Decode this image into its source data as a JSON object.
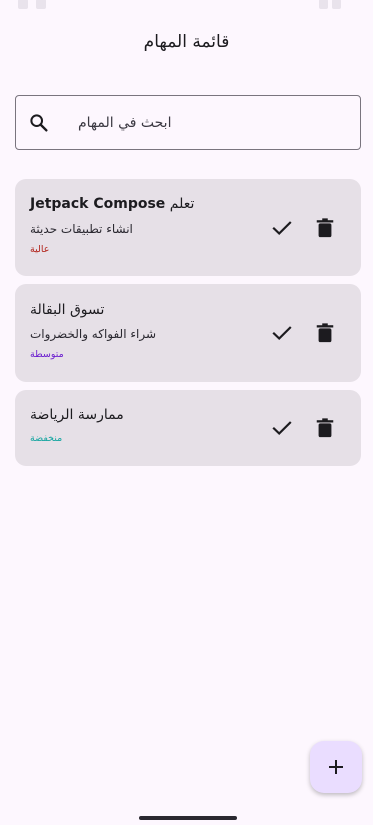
{
  "app": {
    "title": "قائمة المهام"
  },
  "search": {
    "placeholder": "ابحث في المهام"
  },
  "tasks": [
    {
      "title_prefix": "تعلم ",
      "title_bold": "Jetpack Compose",
      "description": "انشاء تطبيقات حديثة",
      "priority": "عالية",
      "priority_color": "#b3261e"
    },
    {
      "title": "تسوق البقالة",
      "description": "شراء الفواكه والخضروات",
      "priority": "متوسطة",
      "priority_color": "#6a1ccf"
    },
    {
      "title": "ممارسة الرياضة",
      "priority": "منخفضة",
      "priority_color": "#14a5a0"
    }
  ],
  "colors": {
    "background": "#fdf7fe",
    "card": "#e6e0e7",
    "fab": "#eaddff"
  },
  "icons": {
    "search": "search-icon",
    "check": "check-icon",
    "delete": "delete-icon",
    "add": "add-icon"
  }
}
